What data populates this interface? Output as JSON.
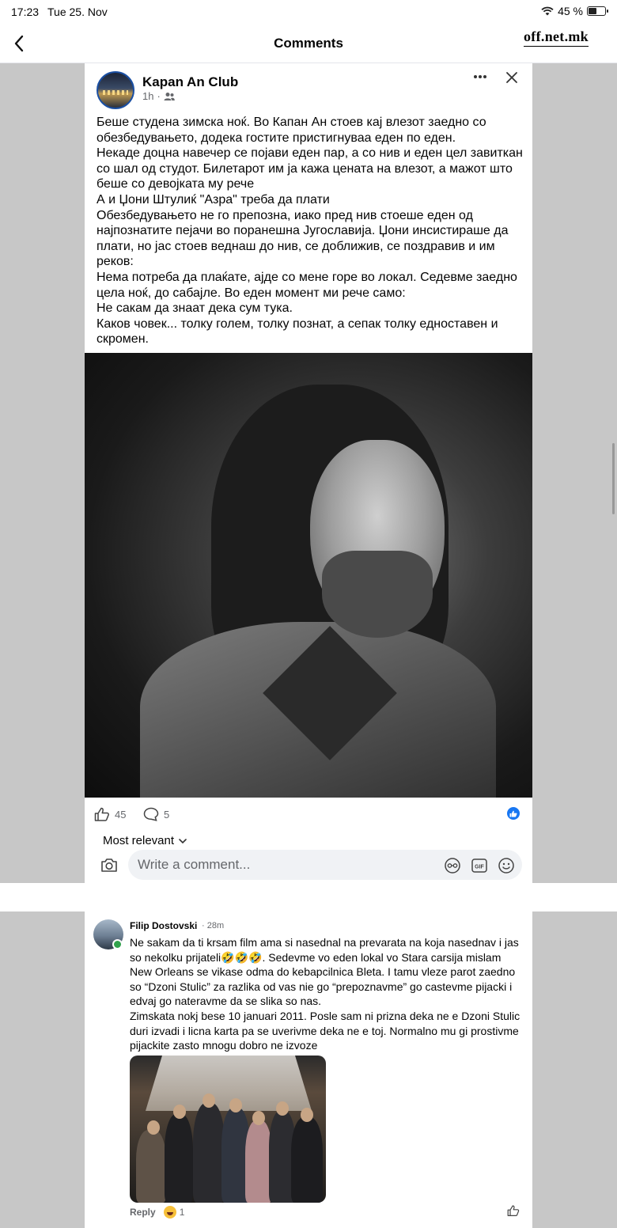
{
  "status_bar": {
    "time": "17:23",
    "date": "Tue 25. Nov",
    "battery_percent": "45 %",
    "battery_level": 0.45
  },
  "nav": {
    "title": "Comments",
    "back_icon": "chevron-left-icon",
    "watermark": "off.net.mk"
  },
  "post": {
    "page_name": "Kapan An Club",
    "time": "1h",
    "audience_icon": "friends-icon",
    "text": "Беше студена зимска ноќ. Во Капан Ан стоев кај влезот заедно со обезбедувањето, додека гостите пристигнуваа еден по еден.\nНекаде доцна навечер се појави еден пар, а со нив и еден цел завиткан со шал од студот. Билетарот им ја кажа цената на влезот, а мажот што беше со девојката му рече\nА и Џони Штулиќ \"Азра\" треба да плати\nОбезбедувањето не го препозна, иако пред нив стоеше еден од најпознатите пејачи во поранешна Југославија. Џони инсистираше да плати, но јас стоев веднаш до нив, се доближив, се поздравив и им реков:\nНема потреба да плаќате, ајде со мене горе во локал. Седевме заедно цела ноќ, до сабајле. Во еден момент ми рече само:\nНе сакам да знаат дека сум тука.\nКаков човек... толку голем, толку познат, а сепак толку едноставен и скромен.",
    "likes": "45",
    "comments": "5"
  },
  "comments_section": {
    "sort_label": "Most relevant",
    "input_placeholder": "Write a comment...",
    "icons": [
      "camera-icon",
      "avatar-sticker-icon",
      "gif-icon",
      "emoji-icon"
    ]
  },
  "comment": {
    "author": "Filip Dostovski",
    "time": "· 28m",
    "text": "Ne sakam da ti krsam film ama si nasednal na prevarata na koja nasednav i jas so nekolku prijateli🤣🤣🤣. Sedevme vo eden lokal vo Stara carsija mislam New Orleans se vikase odma do kebapcilnica Bleta. I tamu vleze parot zaedno so “Dzoni Stulic” za razlika od vas nie go “prepoznavme” go castevme pijacki i edvaj go nateravme da se slika so nas.\nZimskata nokj bese 10 januari 2011. Posle sam ni prizna deka ne e Dzoni Stulic duri izvadi i licna karta pa se uverivme deka ne e toj. Normalno mu gi prostivme pijackite zasto mnogu dobro ne izvoze",
    "reply_label": "Reply",
    "reaction_count": "1"
  },
  "colors": {
    "accent": "#1877f2",
    "background_gray": "#c7c7c7",
    "online": "#31a24c"
  }
}
